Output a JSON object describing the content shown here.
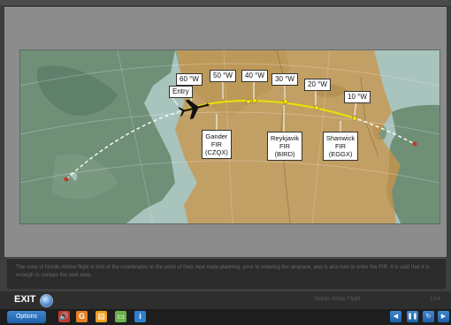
{
  "map": {
    "labels": {
      "entry": "Entry",
      "w60": "60 °W",
      "w50": "50 °W",
      "w40": "40 °W",
      "w30": "30 °W",
      "w20": "20 °W",
      "w10": "10 °W"
    },
    "firs": [
      {
        "line1": "Gander",
        "line2": "FIR",
        "line3": "(CZQX)"
      },
      {
        "line1": "Reykjavik",
        "line2": "FIR",
        "line3": "(BIRD)"
      },
      {
        "line1": "Shanwick",
        "line2": "FIR",
        "line3": "(EGGX)"
      }
    ]
  },
  "caption": "The crew of Nordic Airline flight is told of the coordinates to the point of their next route planning, prior to entering the airspace, and is also told to enter the FIR. It is said that it is enough to contact the next area.",
  "exit_bar": {
    "exit_label": "EXIT",
    "module_title": "Nordic Airline Flight",
    "page": "1/14"
  },
  "toolbar": {
    "options_label": "Options",
    "tools": [
      {
        "name": "audio-icon",
        "glyph": "🔊",
        "color": "#c0392b"
      },
      {
        "name": "glossary-icon",
        "glyph": "G",
        "color": "#e67e22"
      },
      {
        "name": "notes-icon",
        "glyph": "▤",
        "color": "#f0a020"
      },
      {
        "name": "chat-icon",
        "glyph": "▭",
        "color": "#6ab04c"
      },
      {
        "name": "info-icon",
        "glyph": "i",
        "color": "#2f7fd0"
      }
    ],
    "nav": {
      "back": "◀",
      "pause": "❚❚",
      "replay": "↻",
      "next": "▶"
    }
  }
}
